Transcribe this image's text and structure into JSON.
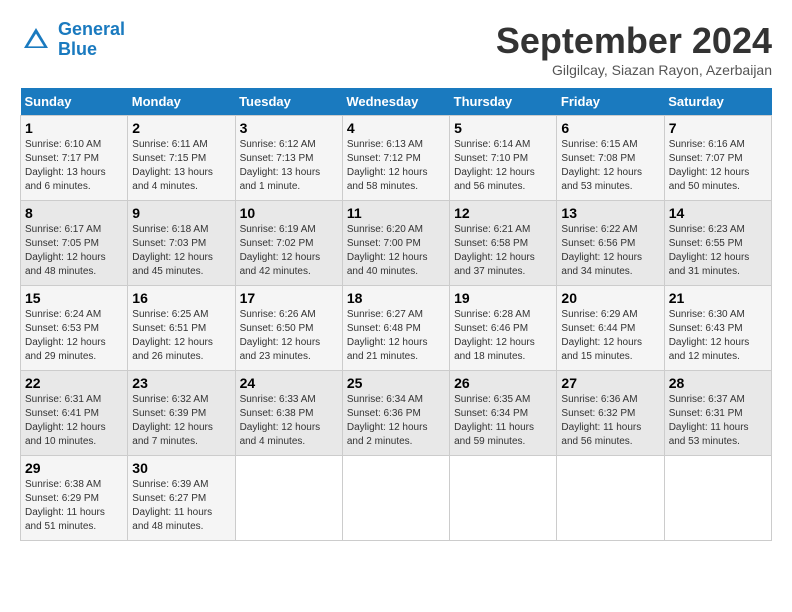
{
  "logo": {
    "line1": "General",
    "line2": "Blue"
  },
  "header": {
    "month": "September 2024",
    "location": "Gilgilcay, Siazan Rayon, Azerbaijan"
  },
  "weekdays": [
    "Sunday",
    "Monday",
    "Tuesday",
    "Wednesday",
    "Thursday",
    "Friday",
    "Saturday"
  ],
  "weeks": [
    [
      {
        "day": "1",
        "sunrise": "6:10 AM",
        "sunset": "7:17 PM",
        "daylight": "13 hours and 6 minutes."
      },
      {
        "day": "2",
        "sunrise": "6:11 AM",
        "sunset": "7:15 PM",
        "daylight": "13 hours and 4 minutes."
      },
      {
        "day": "3",
        "sunrise": "6:12 AM",
        "sunset": "7:13 PM",
        "daylight": "13 hours and 1 minute."
      },
      {
        "day": "4",
        "sunrise": "6:13 AM",
        "sunset": "7:12 PM",
        "daylight": "12 hours and 58 minutes."
      },
      {
        "day": "5",
        "sunrise": "6:14 AM",
        "sunset": "7:10 PM",
        "daylight": "12 hours and 56 minutes."
      },
      {
        "day": "6",
        "sunrise": "6:15 AM",
        "sunset": "7:08 PM",
        "daylight": "12 hours and 53 minutes."
      },
      {
        "day": "7",
        "sunrise": "6:16 AM",
        "sunset": "7:07 PM",
        "daylight": "12 hours and 50 minutes."
      }
    ],
    [
      {
        "day": "8",
        "sunrise": "6:17 AM",
        "sunset": "7:05 PM",
        "daylight": "12 hours and 48 minutes."
      },
      {
        "day": "9",
        "sunrise": "6:18 AM",
        "sunset": "7:03 PM",
        "daylight": "12 hours and 45 minutes."
      },
      {
        "day": "10",
        "sunrise": "6:19 AM",
        "sunset": "7:02 PM",
        "daylight": "12 hours and 42 minutes."
      },
      {
        "day": "11",
        "sunrise": "6:20 AM",
        "sunset": "7:00 PM",
        "daylight": "12 hours and 40 minutes."
      },
      {
        "day": "12",
        "sunrise": "6:21 AM",
        "sunset": "6:58 PM",
        "daylight": "12 hours and 37 minutes."
      },
      {
        "day": "13",
        "sunrise": "6:22 AM",
        "sunset": "6:56 PM",
        "daylight": "12 hours and 34 minutes."
      },
      {
        "day": "14",
        "sunrise": "6:23 AM",
        "sunset": "6:55 PM",
        "daylight": "12 hours and 31 minutes."
      }
    ],
    [
      {
        "day": "15",
        "sunrise": "6:24 AM",
        "sunset": "6:53 PM",
        "daylight": "12 hours and 29 minutes."
      },
      {
        "day": "16",
        "sunrise": "6:25 AM",
        "sunset": "6:51 PM",
        "daylight": "12 hours and 26 minutes."
      },
      {
        "day": "17",
        "sunrise": "6:26 AM",
        "sunset": "6:50 PM",
        "daylight": "12 hours and 23 minutes."
      },
      {
        "day": "18",
        "sunrise": "6:27 AM",
        "sunset": "6:48 PM",
        "daylight": "12 hours and 21 minutes."
      },
      {
        "day": "19",
        "sunrise": "6:28 AM",
        "sunset": "6:46 PM",
        "daylight": "12 hours and 18 minutes."
      },
      {
        "day": "20",
        "sunrise": "6:29 AM",
        "sunset": "6:44 PM",
        "daylight": "12 hours and 15 minutes."
      },
      {
        "day": "21",
        "sunrise": "6:30 AM",
        "sunset": "6:43 PM",
        "daylight": "12 hours and 12 minutes."
      }
    ],
    [
      {
        "day": "22",
        "sunrise": "6:31 AM",
        "sunset": "6:41 PM",
        "daylight": "12 hours and 10 minutes."
      },
      {
        "day": "23",
        "sunrise": "6:32 AM",
        "sunset": "6:39 PM",
        "daylight": "12 hours and 7 minutes."
      },
      {
        "day": "24",
        "sunrise": "6:33 AM",
        "sunset": "6:38 PM",
        "daylight": "12 hours and 4 minutes."
      },
      {
        "day": "25",
        "sunrise": "6:34 AM",
        "sunset": "6:36 PM",
        "daylight": "12 hours and 2 minutes."
      },
      {
        "day": "26",
        "sunrise": "6:35 AM",
        "sunset": "6:34 PM",
        "daylight": "11 hours and 59 minutes."
      },
      {
        "day": "27",
        "sunrise": "6:36 AM",
        "sunset": "6:32 PM",
        "daylight": "11 hours and 56 minutes."
      },
      {
        "day": "28",
        "sunrise": "6:37 AM",
        "sunset": "6:31 PM",
        "daylight": "11 hours and 53 minutes."
      }
    ],
    [
      {
        "day": "29",
        "sunrise": "6:38 AM",
        "sunset": "6:29 PM",
        "daylight": "11 hours and 51 minutes."
      },
      {
        "day": "30",
        "sunrise": "6:39 AM",
        "sunset": "6:27 PM",
        "daylight": "11 hours and 48 minutes."
      },
      null,
      null,
      null,
      null,
      null
    ]
  ]
}
